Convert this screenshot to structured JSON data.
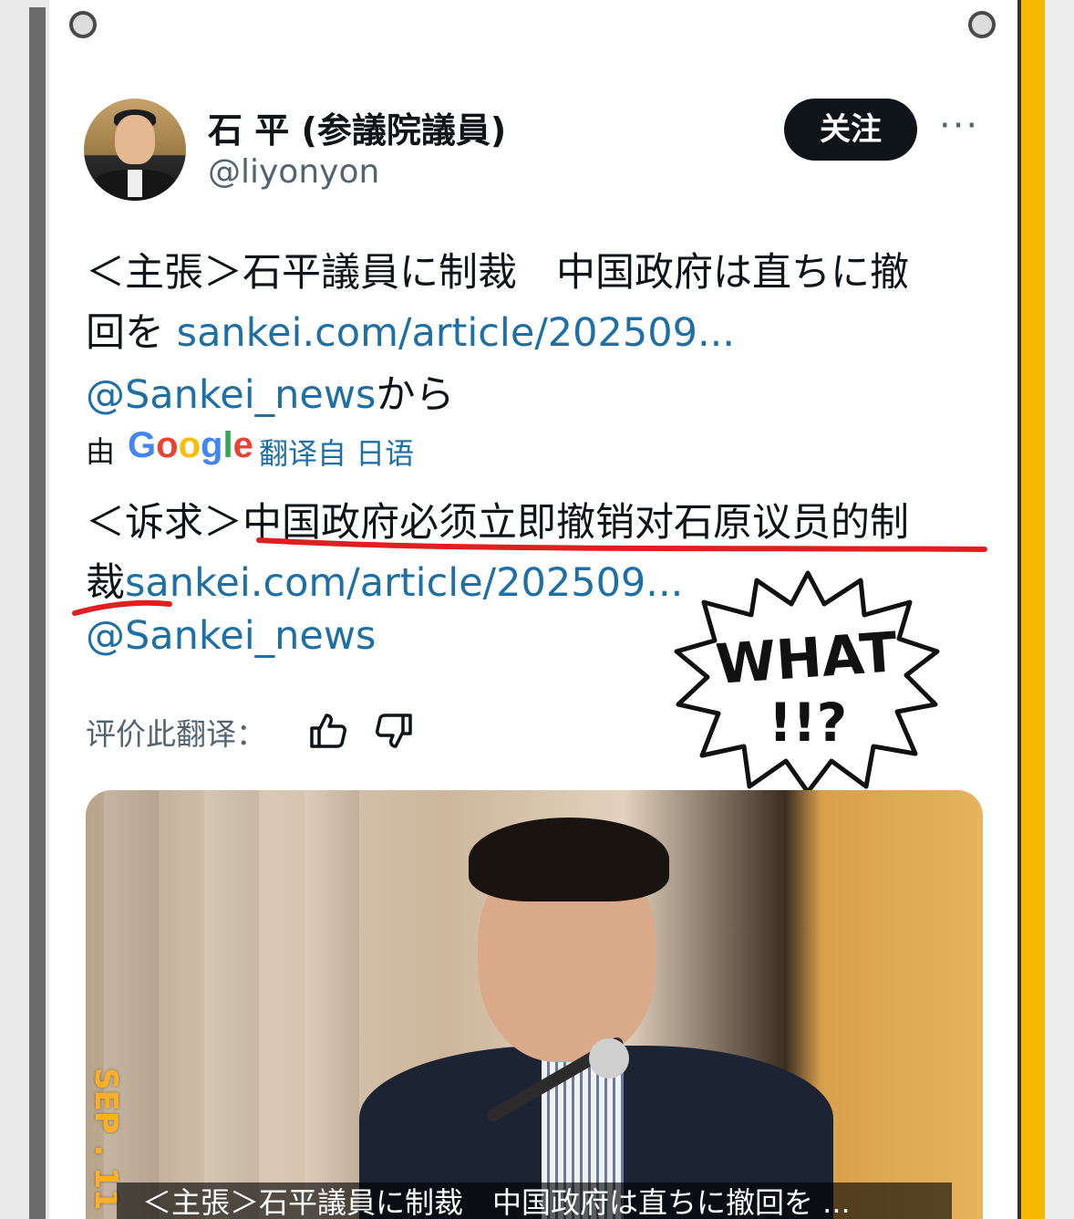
{
  "tweet": {
    "author_name": "石 平 (参議院議員)",
    "author_handle": "@liyonyon",
    "follow_label": "关注",
    "more_icon": "···",
    "original": {
      "line1": "＜主張＞石平議員に制裁　中国政府は直ちに撤",
      "line2_text": "回を ",
      "line2_link": "sankei.com/article/202509...",
      "line3_link": "@Sankei_news",
      "line3_text": "から"
    },
    "translation_bar": {
      "prefix": "由",
      "google": [
        "G",
        "o",
        "o",
        "g",
        "l",
        "e"
      ],
      "from": "翻译自 日语"
    },
    "translated": {
      "line1": "＜诉求＞中国政府必须立即撤销对石原议员的制",
      "line2_text": "裁",
      "line2_link": "sankei.com/article/202509...",
      "line3_link": "@Sankei_news"
    },
    "rate_label": "评价此翻译：",
    "sticker": {
      "line1": "WHAT",
      "line2": "!!?"
    },
    "media": {
      "date_stamp": "SEP . 11",
      "caption": "＜主張＞石平議員に制裁　中国政府は直ちに撤回を ..."
    }
  },
  "colors": {
    "link": "#1d6fa5",
    "follow_bg": "#0f1419",
    "underline": "#e02020",
    "frame_accent": "#f5b700"
  }
}
